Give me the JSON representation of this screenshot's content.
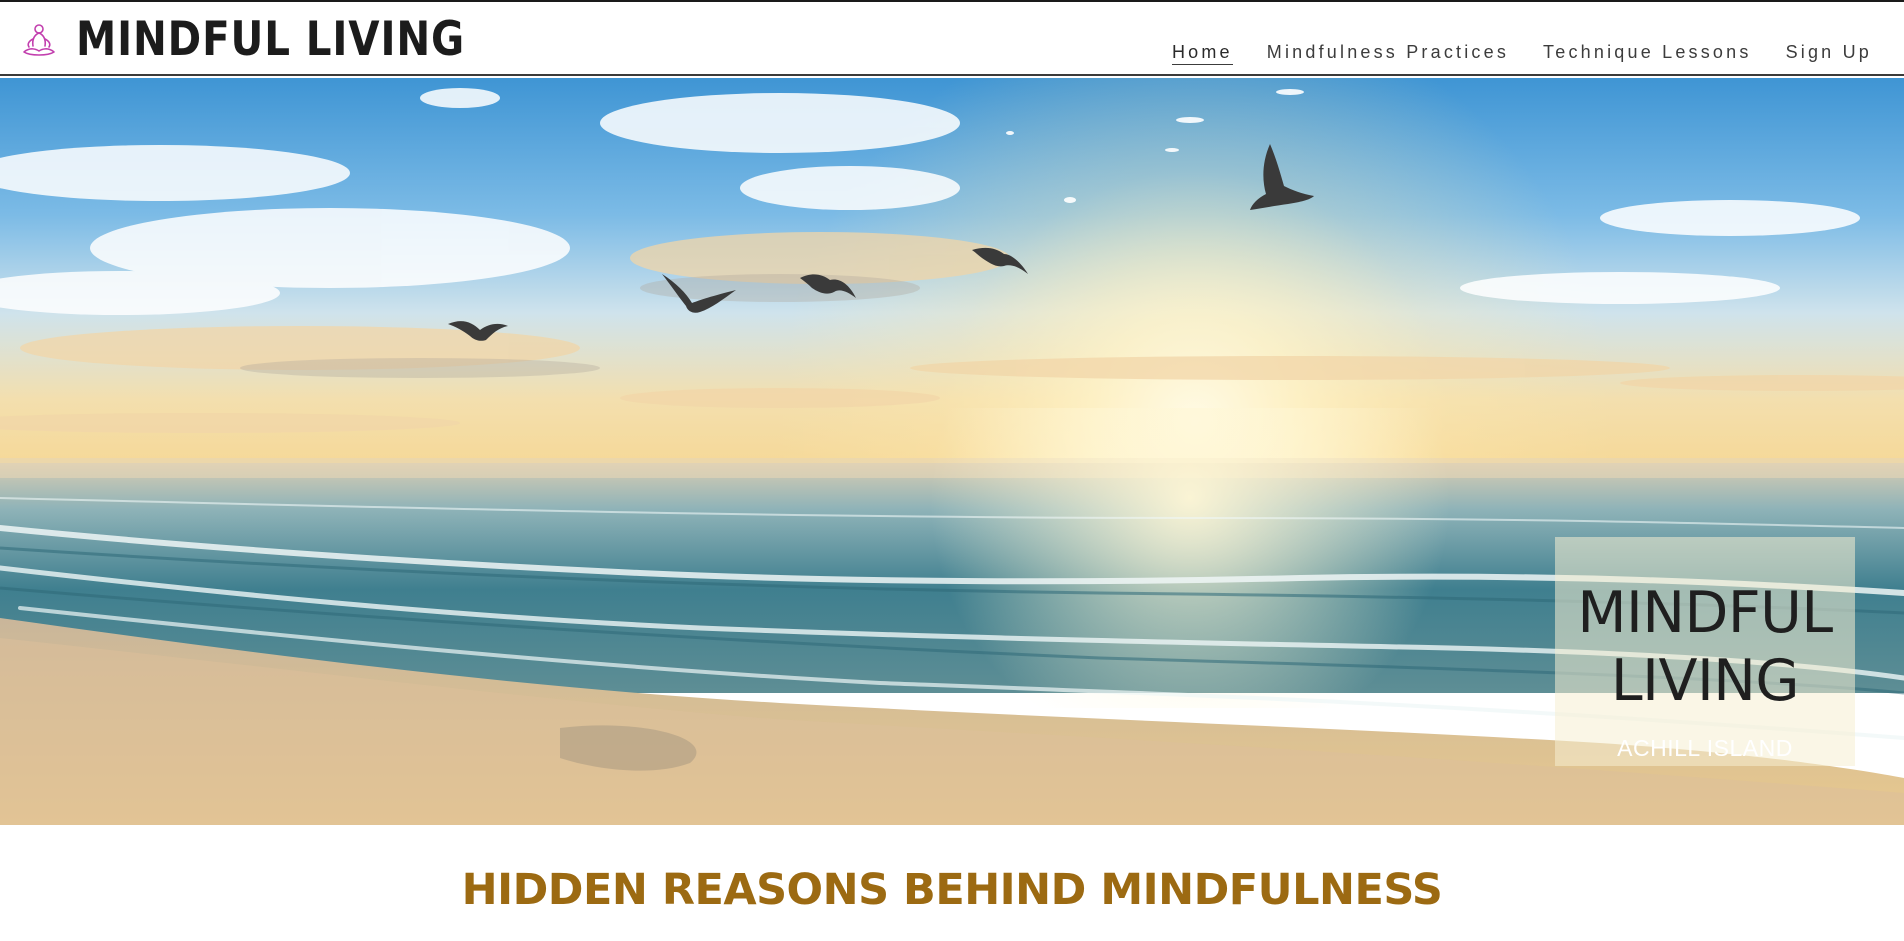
{
  "header": {
    "site_title": "MINDFUL LIVING",
    "logo_icon": "meditation-icon"
  },
  "nav": {
    "items": [
      {
        "label": "Home",
        "active": true
      },
      {
        "label": "Mindfulness Practices",
        "active": false
      },
      {
        "label": "Technique Lessons",
        "active": false
      },
      {
        "label": "Sign Up",
        "active": false
      }
    ]
  },
  "hero": {
    "image": "seascape-sunset-with-seagulls",
    "title_line1": "MINDFUL",
    "title_line2": "LIVING",
    "subtitle": "ACHILL ISLAND"
  },
  "main": {
    "section_title": "HIDDEN REASONS BEHIND MINDFULNESS"
  },
  "colors": {
    "accent": "#9c6a12",
    "logo_icon": "#c23fae",
    "text_dark": "#1c1c1c"
  }
}
